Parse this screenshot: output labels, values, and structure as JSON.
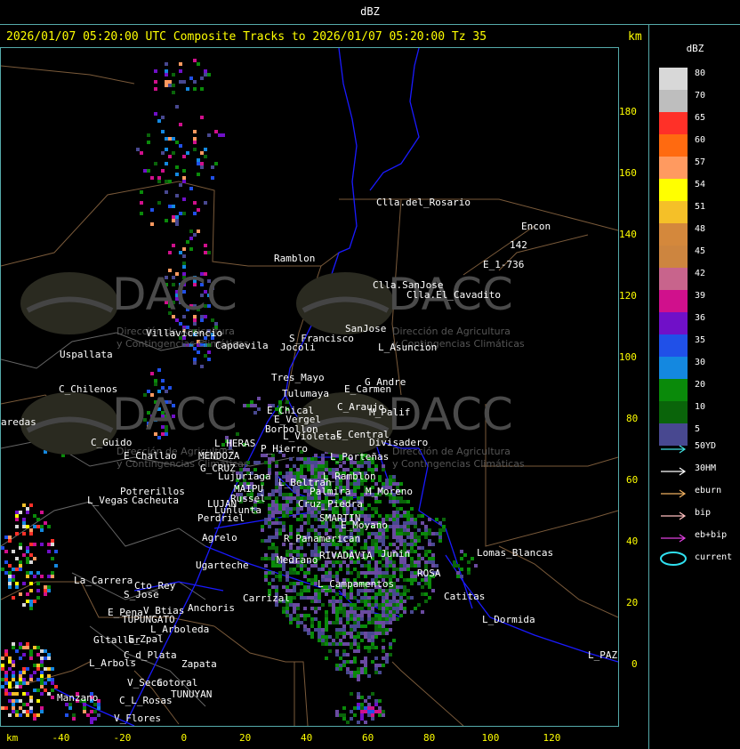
{
  "header": {
    "units_label": "dBZ",
    "title": "2026/01/07 05:20:00 UTC Composite Tracks to 2026/01/07 05:20:00 Tz 35",
    "km_label": "km"
  },
  "axes": {
    "x_label": "km",
    "x_ticks": [
      "-40",
      "-20",
      "0",
      "20",
      "40",
      "60",
      "80",
      "100",
      "120"
    ],
    "y_ticks": [
      "180",
      "160",
      "140",
      "120",
      "100",
      "80",
      "60",
      "40",
      "20",
      "0"
    ]
  },
  "legend": {
    "title": "dBZ",
    "scale": [
      {
        "value": "80",
        "color": "#d8d8d8"
      },
      {
        "value": "70",
        "color": "#bebebe"
      },
      {
        "value": "65",
        "color": "#ff3028"
      },
      {
        "value": "60",
        "color": "#ff6a10"
      },
      {
        "value": "57",
        "color": "#ff9a60"
      },
      {
        "value": "54",
        "color": "#ffff00"
      },
      {
        "value": "51",
        "color": "#f5c028"
      },
      {
        "value": "48",
        "color": "#d4883c"
      },
      {
        "value": "45",
        "color": "#cd853f"
      },
      {
        "value": "42",
        "color": "#c8648c"
      },
      {
        "value": "39",
        "color": "#d0108c"
      },
      {
        "value": "36",
        "color": "#7010c8"
      },
      {
        "value": "35",
        "color": "#2050e8"
      },
      {
        "value": "30",
        "color": "#1488e0"
      },
      {
        "value": "20",
        "color": "#0a8a0a"
      },
      {
        "value": "10",
        "color": "#0a640a"
      },
      {
        "value": "5",
        "color": "#484890"
      }
    ],
    "tracks": [
      {
        "label": "50YD",
        "color": "#40e0e0"
      },
      {
        "label": "30HM",
        "color": "#ffffff"
      },
      {
        "label": "eburn",
        "color": "#f0b060"
      },
      {
        "label": "bip",
        "color": "#ffc0c0"
      },
      {
        "label": "eb+bip",
        "color": "#e040e0"
      },
      {
        "label": "current",
        "color": "#30e0f0"
      }
    ]
  },
  "watermark": {
    "name": "DACC",
    "line1": "Dirección de Agricultura",
    "line2": "y Contingencias Climáticas"
  },
  "places": [
    {
      "name": "Clla.del_Rosario"
    },
    {
      "name": "Encon"
    },
    {
      "name": "142"
    },
    {
      "name": "E_1-736"
    },
    {
      "name": "Ramblon"
    },
    {
      "name": "Clla.SanJose"
    },
    {
      "name": "Clla.El_Cavadito"
    },
    {
      "name": "Villavicencio"
    },
    {
      "name": "Capdevila"
    },
    {
      "name": "S_Francisco"
    },
    {
      "name": "SanJose"
    },
    {
      "name": "Jocoli"
    },
    {
      "name": "L_Asuncion"
    },
    {
      "name": "Uspallata"
    },
    {
      "name": "Tres_Mayo"
    },
    {
      "name": "G_Andre"
    },
    {
      "name": "E_Carmen"
    },
    {
      "name": "C_Chilenos"
    },
    {
      "name": "Tulumaya"
    },
    {
      "name": "C_Araujo"
    },
    {
      "name": "E_Chical"
    },
    {
      "name": "M_Palif"
    },
    {
      "name": "E_Vergel"
    },
    {
      "name": "aredas"
    },
    {
      "name": "Borbollon"
    },
    {
      "name": "L_Violetas"
    },
    {
      "name": "E_Central"
    },
    {
      "name": "Divisadero"
    },
    {
      "name": "C_Guido"
    },
    {
      "name": "L_HERAS"
    },
    {
      "name": "P_Hierro"
    },
    {
      "name": "E_Challao"
    },
    {
      "name": "MENDOZA"
    },
    {
      "name": "L_Porteñas"
    },
    {
      "name": "G_CRUZ"
    },
    {
      "name": "Lujuriaga"
    },
    {
      "name": "L_Ramblon"
    },
    {
      "name": "L_Beltran"
    },
    {
      "name": "MAIPU"
    },
    {
      "name": "Potrerillos"
    },
    {
      "name": "Russel"
    },
    {
      "name": "Palmira"
    },
    {
      "name": "M_Moreno"
    },
    {
      "name": "L_Vegas"
    },
    {
      "name": "Cacheuta"
    },
    {
      "name": "LUJAN"
    },
    {
      "name": "Cruz_Piedra"
    },
    {
      "name": "Lunlunta"
    },
    {
      "name": "SMARTIN"
    },
    {
      "name": "Perdriel"
    },
    {
      "name": "E_Moyano"
    },
    {
      "name": "Agrelo"
    },
    {
      "name": "R_Panamerican"
    },
    {
      "name": "Lomas_Blancas"
    },
    {
      "name": "RIVADAVIA"
    },
    {
      "name": "Ugarteche"
    },
    {
      "name": "ROSA"
    },
    {
      "name": "La_Carrera"
    },
    {
      "name": "Cto_Rey"
    },
    {
      "name": "Medrano"
    },
    {
      "name": "Junin"
    },
    {
      "name": "Catitas"
    },
    {
      "name": "S_Jose"
    },
    {
      "name": "Carrizal"
    },
    {
      "name": "L_Campamentos"
    },
    {
      "name": "Anchoris"
    },
    {
      "name": "E_Pena"
    },
    {
      "name": "V_Btias"
    },
    {
      "name": "L_Dormida"
    },
    {
      "name": "TUPUNGATO"
    },
    {
      "name": "L_Arboleda"
    },
    {
      "name": "Gltallar"
    },
    {
      "name": "E_Zpal"
    },
    {
      "name": "L_PAZ"
    },
    {
      "name": "C_d_Plata"
    },
    {
      "name": "L_Arbols"
    },
    {
      "name": "Zapata"
    },
    {
      "name": "V_Seca"
    },
    {
      "name": "Cotoral"
    },
    {
      "name": "TUNUYAN"
    },
    {
      "name": "Manzano"
    },
    {
      "name": "C_L_Rosas"
    },
    {
      "name": "V_Flores"
    }
  ]
}
